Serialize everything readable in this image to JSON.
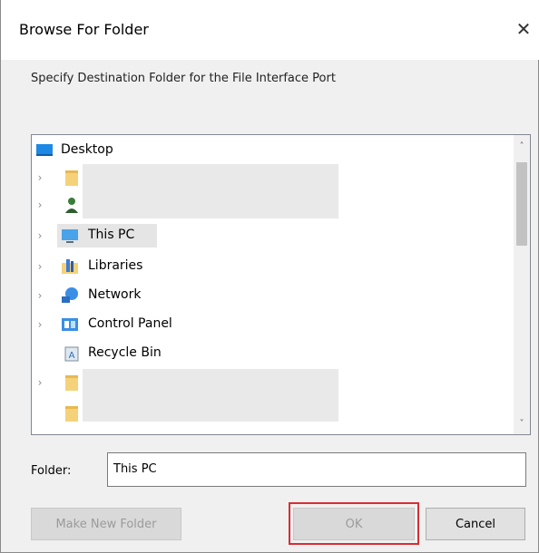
{
  "dialog": {
    "title": "Browse For Folder",
    "close_glyph": "✕",
    "prompt": "Specify Destination Folder for the File Interface Port"
  },
  "tree": {
    "items": [
      {
        "label": "Desktop",
        "icon": "desktop-icon",
        "expandable": false,
        "selected": false
      },
      {
        "label": "",
        "icon": "folder-icon",
        "expandable": true,
        "selected": false,
        "redacted": true
      },
      {
        "label": "",
        "icon": "user-icon",
        "expandable": true,
        "selected": false,
        "redacted": true
      },
      {
        "label": "This PC",
        "icon": "computer-icon",
        "expandable": true,
        "selected": true
      },
      {
        "label": "Libraries",
        "icon": "libraries-icon",
        "expandable": true,
        "selected": false
      },
      {
        "label": "Network",
        "icon": "network-icon",
        "expandable": true,
        "selected": false
      },
      {
        "label": "Control Panel",
        "icon": "control-panel-icon",
        "expandable": true,
        "selected": false
      },
      {
        "label": "Recycle Bin",
        "icon": "recycle-bin-icon",
        "expandable": false,
        "selected": false
      },
      {
        "label": "",
        "icon": "folder-icon",
        "expandable": true,
        "selected": false,
        "redacted": true
      },
      {
        "label": "",
        "icon": "folder-icon",
        "expandable": false,
        "selected": false,
        "redacted": true
      }
    ],
    "expander_glyph": "›",
    "scroll_up_glyph": "˄",
    "scroll_down_glyph": "˅"
  },
  "folder": {
    "label": "Folder:",
    "value": "This PC"
  },
  "buttons": {
    "make_new_folder": "Make New Folder",
    "ok": "OK",
    "cancel": "Cancel"
  },
  "colors": {
    "highlight": "#d82d35",
    "folder": "#f5d27a",
    "accent": "#1e88e5"
  }
}
